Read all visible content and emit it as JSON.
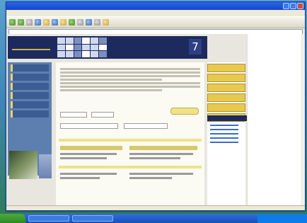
{
  "window": {
    "title": ""
  },
  "menus": [
    "",
    "",
    "",
    "",
    "",
    ""
  ],
  "address": {
    "value": ""
  },
  "page": {
    "header_logo": "",
    "header_badge": "7"
  },
  "left_nav": [
    "",
    "",
    "",
    "",
    "",
    ""
  ],
  "right_nav": [
    "",
    "",
    "",
    "",
    "",
    ""
  ],
  "right_box_title": "",
  "taskbar": {
    "start": "",
    "tasks": [
      "",
      ""
    ],
    "clock": ""
  }
}
